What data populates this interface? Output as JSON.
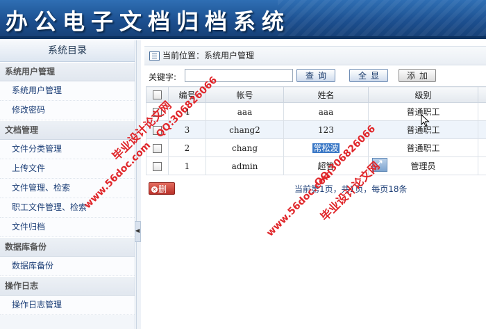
{
  "banner": {
    "title": "办公电子文档归档系统"
  },
  "sidebar": {
    "title": "系统目录",
    "groups": [
      {
        "label": "系统用户管理",
        "items": [
          {
            "label": "系统用户管理"
          },
          {
            "label": "修改密码"
          }
        ]
      },
      {
        "label": "文档管理",
        "items": [
          {
            "label": "文件分类管理"
          },
          {
            "label": "上传文件"
          },
          {
            "label": "文件管理、检索"
          },
          {
            "label": "职工文件管理、检索"
          },
          {
            "label": "文件归档"
          }
        ]
      },
      {
        "label": "数据库备份",
        "items": [
          {
            "label": "数据库备份"
          }
        ]
      },
      {
        "label": "操作日志",
        "items": [
          {
            "label": "操作日志管理"
          }
        ]
      }
    ]
  },
  "breadcrumb": {
    "text": "当前位置：系统用户管理"
  },
  "search": {
    "label": "关键字:",
    "value": "",
    "buttons": {
      "query": "查询",
      "show_all": "全显",
      "add": "添加"
    }
  },
  "table": {
    "columns": [
      "",
      "编号",
      "帐号",
      "姓名",
      "级别"
    ],
    "rows": [
      {
        "id": "4",
        "account": "aaa",
        "name": "aaa",
        "level": "普通职工"
      },
      {
        "id": "3",
        "account": "chang2",
        "name": "123",
        "level": "普通职工"
      },
      {
        "id": "2",
        "account": "chang",
        "name": "常松波",
        "level": "普通职工"
      },
      {
        "id": "1",
        "account": "admin",
        "name": "超管",
        "level": "管理员"
      }
    ]
  },
  "actions": {
    "delete": "删除"
  },
  "pager": {
    "text": "当前第1页，共1页，每页18条"
  },
  "watermarks": {
    "qq": "QQ:306826066",
    "site": "www.56doc.com",
    "brand": "毕业设计论文网"
  },
  "colors": {
    "banner": "#1c4f8f",
    "accent": "#1d3f77",
    "watermark": "#e0262a",
    "delete": "#b9322a"
  }
}
